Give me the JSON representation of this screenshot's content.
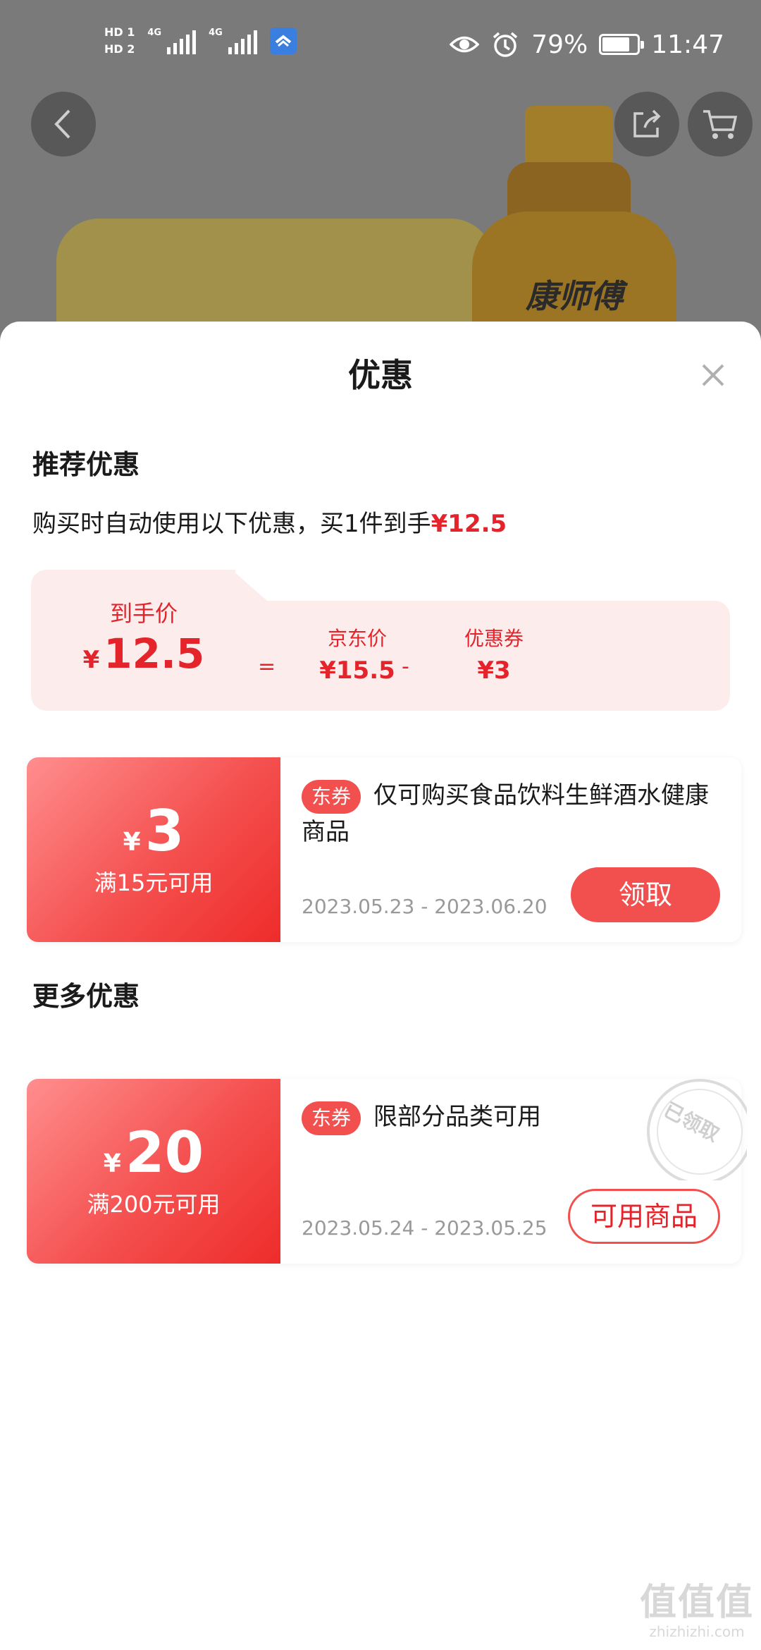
{
  "status_bar": {
    "hd1": "HD 1",
    "hd2": "HD 2",
    "net1": "4G",
    "net2": "4G",
    "battery_percent": "79%",
    "battery_level": 0.79,
    "time": "11:47"
  },
  "product_bg": {
    "brand_label": "康师傅"
  },
  "sheet": {
    "title": "优惠",
    "recommended": {
      "heading": "推荐优惠",
      "desc_prefix": "购买时自动使用以下优惠，买1件到手",
      "desc_price": "¥12.5",
      "breakdown": {
        "final_label": "到手价",
        "final_currency": "¥",
        "final_value": "12.5",
        "equals": "=",
        "jd_label": "京东价",
        "jd_value": "¥15.5",
        "minus": "-",
        "coupon_label": "优惠券",
        "coupon_value": "¥3"
      }
    },
    "coupon1": {
      "currency": "¥",
      "amount": "3",
      "condition": "满15元可用",
      "tag": "东券",
      "text": "仅可购买食品饮料生鲜酒水健康商品",
      "date": "2023.05.23 - 2023.06.20",
      "button": "领取"
    },
    "more": {
      "heading": "更多优惠"
    },
    "coupon2": {
      "currency": "¥",
      "amount": "20",
      "condition": "满200元可用",
      "tag": "东券",
      "text": "限部分品类可用",
      "date": "2023.05.24 - 2023.05.25",
      "button": "可用商品",
      "stamp": "已领取"
    }
  },
  "watermark": {
    "logo": "值值值",
    "url": "zhizhizhi.com"
  },
  "colors": {
    "accent_red": "#e4232b",
    "coupon_red": "#f2504e",
    "breakdown_bg": "#fdecec",
    "date_gray": "#999999"
  },
  "icons": {
    "back": "chevron-left-icon",
    "share": "share-icon",
    "cart": "cart-icon",
    "close": "close-icon",
    "eye": "eye-icon",
    "alarm": "alarm-icon"
  }
}
